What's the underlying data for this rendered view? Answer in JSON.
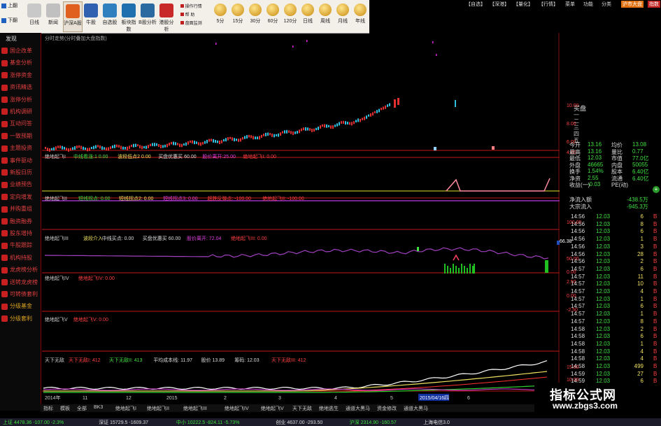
{
  "toolbar": {
    "left_buttons": [
      {
        "label": "上翻",
        "icon": "page-up-icon"
      },
      {
        "label": "下翻",
        "icon": "page-down-icon"
      }
    ],
    "buttons": [
      {
        "label": "日线",
        "icon": "daily-icon",
        "color": "#c8c8c8"
      },
      {
        "label": "新闻",
        "icon": "news-icon",
        "color": "#c0c0c0"
      },
      {
        "label": "沪深A股",
        "icon": "stocks-icon",
        "color": "#e06020"
      },
      {
        "label": "牛股",
        "icon": "bull-icon",
        "color": "#3060b0"
      },
      {
        "label": "自选股",
        "icon": "favorite-icon",
        "color": "#3080c0"
      },
      {
        "label": "板块指数",
        "icon": "sector-icon",
        "color": "#2070b0"
      },
      {
        "label": "B股分析",
        "icon": "b-share-icon",
        "color": "#2a6aa0"
      },
      {
        "label": "港股分析",
        "icon": "hk-icon",
        "color": "#c82828"
      }
    ],
    "mini_items": [
      "操作行情",
      "帮 助",
      "盘面监测"
    ],
    "periods": [
      "5分",
      "15分",
      "30分",
      "60分",
      "120分",
      "日线",
      "周线",
      "月线",
      "年线"
    ]
  },
  "menubar": {
    "items": [
      "【自选】",
      "【深港】",
      "【量化】",
      "【行情】",
      "菜单",
      "功能",
      "分类",
      "沪市大盘",
      "指数"
    ]
  },
  "sidebar": {
    "header": "发现",
    "items": [
      "国企改革",
      "基金分析",
      "涨停资金",
      "资讯精选",
      "涨停分析",
      "机构调研",
      "互动问答",
      "一致预期",
      "主题投资",
      "事件驱动",
      "新股日历",
      "业绩预告",
      "定向增发",
      "并购重组",
      "融资融券",
      "股东增持",
      "牛股跟踪",
      "机构持股",
      "龙虎榜分析",
      "送转龙虎榜",
      "可转债套利",
      "分级基金",
      "分级套利"
    ]
  },
  "main_chart": {
    "title": "分时走势(分时叠加大盘指数)",
    "y_labels": [
      "10.00",
      "8.00",
      "6.00",
      "4.00"
    ]
  },
  "panels": {
    "p1": {
      "title": "绝地起飞I",
      "items": [
        "中线看涨:1 0.00",
        "波段低点2 0.00",
        "买盘优惠买 60.00",
        "股价离开:25.00",
        "绝地起飞I: 0.00"
      ]
    },
    "p2": {
      "title": "绝地起飞II",
      "items": [
        "短线拐点: 0.00",
        "短线拐点2: 0.00",
        "短线拐点3: 0.00",
        "超跌反弹点: -100.00",
        "绝地起飞II: -100.00"
      ]
    },
    "p3": {
      "title": "绝地起飞III",
      "items": [
        "波段介入",
        "中线买点: 0.00",
        "买盘优惠买 60.00",
        "股价离开: 72.04",
        "绝地起飞III: 0.00"
      ],
      "badge": "66.38",
      "y_labels": [
        "100.00",
        "50.00",
        "0.00"
      ]
    },
    "p4": {
      "title": "绝地起飞IV",
      "items": [
        "绝地起飞IV: 0.00"
      ],
      "y_labels": [
        "2.50",
        "0.00"
      ]
    },
    "p5": {
      "title": "绝地起飞V",
      "items": [
        "绝地起飞V: 0.00"
      ],
      "y_labels": [
        "-2.50"
      ]
    },
    "p6": {
      "title": "天下无敌",
      "items": [
        "天下无敌I: 412",
        "天下无敌II: 413",
        "平均成本线: 11.97",
        "股价 13.89",
        "筹码: 12.03",
        "天下无敌III: 412"
      ],
      "y_labels": [
        "15.00",
        "10.00",
        "5.00"
      ]
    }
  },
  "xaxis": {
    "labels": [
      "2014年",
      "11",
      "12",
      "2015",
      "2",
      "3",
      "4",
      "5",
      "6"
    ],
    "cursor_date": "2015/04/16四"
  },
  "tabs": [
    "指标",
    "模板",
    "全部",
    "BK3",
    "绝地起飞I",
    "绝地起飞II",
    "绝地起飞III",
    "绝地起飞IV",
    "绝地起飞V",
    "天下无敌",
    "绝地逃生",
    "通道大黑马",
    "资金修改",
    "通道大黑马"
  ],
  "quote": {
    "header": "买盘",
    "rows": [
      {
        "l": "今开",
        "lv": "13.16",
        "r": "均价",
        "rv": "13.08"
      },
      {
        "l": "最高",
        "lv": "13.16",
        "r": "量比",
        "rv": "0.77"
      },
      {
        "l": "最低",
        "lv": "12.03",
        "r": "市值",
        "rv": "77.0亿"
      },
      {
        "l": "外盘",
        "lv": "46665",
        "r": "内盘",
        "rv": "50055"
      },
      {
        "l": "换手",
        "lv": "1.54%",
        "r": "股本",
        "rv": "6.40亿"
      },
      {
        "l": "净资",
        "lv": "2.55",
        "r": "流通",
        "rv": "6.40亿"
      },
      {
        "l": "收益(一)",
        "lv": "-0.03",
        "r": "PE(动)",
        "rv": ""
      }
    ],
    "flows": [
      {
        "l": "净流入额",
        "v": "-438.5万"
      },
      {
        "l": "大宗流入",
        "v": "-945.3万"
      }
    ]
  },
  "ticks": [
    {
      "t": "14:56",
      "p": "12.03",
      "v": "6",
      "c": "B"
    },
    {
      "t": "14:56",
      "p": "12.03",
      "v": "8",
      "c": "B"
    },
    {
      "t": "14:56",
      "p": "12.03",
      "v": "6",
      "c": "B"
    },
    {
      "t": "14:56",
      "p": "12.03",
      "v": "1",
      "c": "B"
    },
    {
      "t": "14:56",
      "p": "12.03",
      "v": "3",
      "c": "B"
    },
    {
      "t": "14:56",
      "p": "12.03",
      "v": "28",
      "c": "B"
    },
    {
      "t": "14:56",
      "p": "12.03",
      "v": "2",
      "c": "B"
    },
    {
      "t": "14:57",
      "p": "12.03",
      "v": "6",
      "c": "B"
    },
    {
      "t": "14:57",
      "p": "12.03",
      "v": "11",
      "c": "B"
    },
    {
      "t": "14:57",
      "p": "12.03",
      "v": "10",
      "c": "B"
    },
    {
      "t": "14:57",
      "p": "12.03",
      "v": "4",
      "c": "B"
    },
    {
      "t": "14:57",
      "p": "12.03",
      "v": "1",
      "c": "B"
    },
    {
      "t": "14:57",
      "p": "12.03",
      "v": "6",
      "c": "B"
    },
    {
      "t": "14:57",
      "p": "12.03",
      "v": "1",
      "c": "B"
    },
    {
      "t": "14:57",
      "p": "12.03",
      "v": "8",
      "c": "B"
    },
    {
      "t": "14:58",
      "p": "12.03",
      "v": "2",
      "c": "B"
    },
    {
      "t": "14:58",
      "p": "12.03",
      "v": "6",
      "c": "B"
    },
    {
      "t": "14:58",
      "p": "12.03",
      "v": "1",
      "c": "B"
    },
    {
      "t": "14:58",
      "p": "12.03",
      "v": "4",
      "c": "B"
    },
    {
      "t": "14:58",
      "p": "12.03",
      "v": "4",
      "c": "B"
    },
    {
      "t": "14:58",
      "p": "12.03",
      "v": "499",
      "c": "B"
    },
    {
      "t": "14:59",
      "p": "12.03",
      "v": "27",
      "c": "B"
    },
    {
      "t": "14:59",
      "p": "12.03",
      "v": "6",
      "c": "B"
    },
    {
      "t": "14:59",
      "p": "12.03",
      "v": "2",
      "c": "B"
    },
    {
      "t": "14:59",
      "p": "12.03",
      "v": "2",
      "c": "B"
    },
    {
      "t": "14:59",
      "p": "12.03",
      "v": "8",
      "c": "B"
    },
    {
      "t": "14:59",
      "p": "12.03",
      "v": "3",
      "c": "B"
    }
  ],
  "statusbar": {
    "items": [
      "上证 4478.36 -107.00 -2.3%",
      "深证 15729.5 -1609.37",
      "中小 10222.5 -824.11 -5.73%",
      "创业 4637.00 -293.50",
      "沪深 2314.90 -160.57",
      "上海电信3.0"
    ]
  },
  "watermark": {
    "cn": "指标公式网",
    "url": "www.zbgs3.com"
  }
}
